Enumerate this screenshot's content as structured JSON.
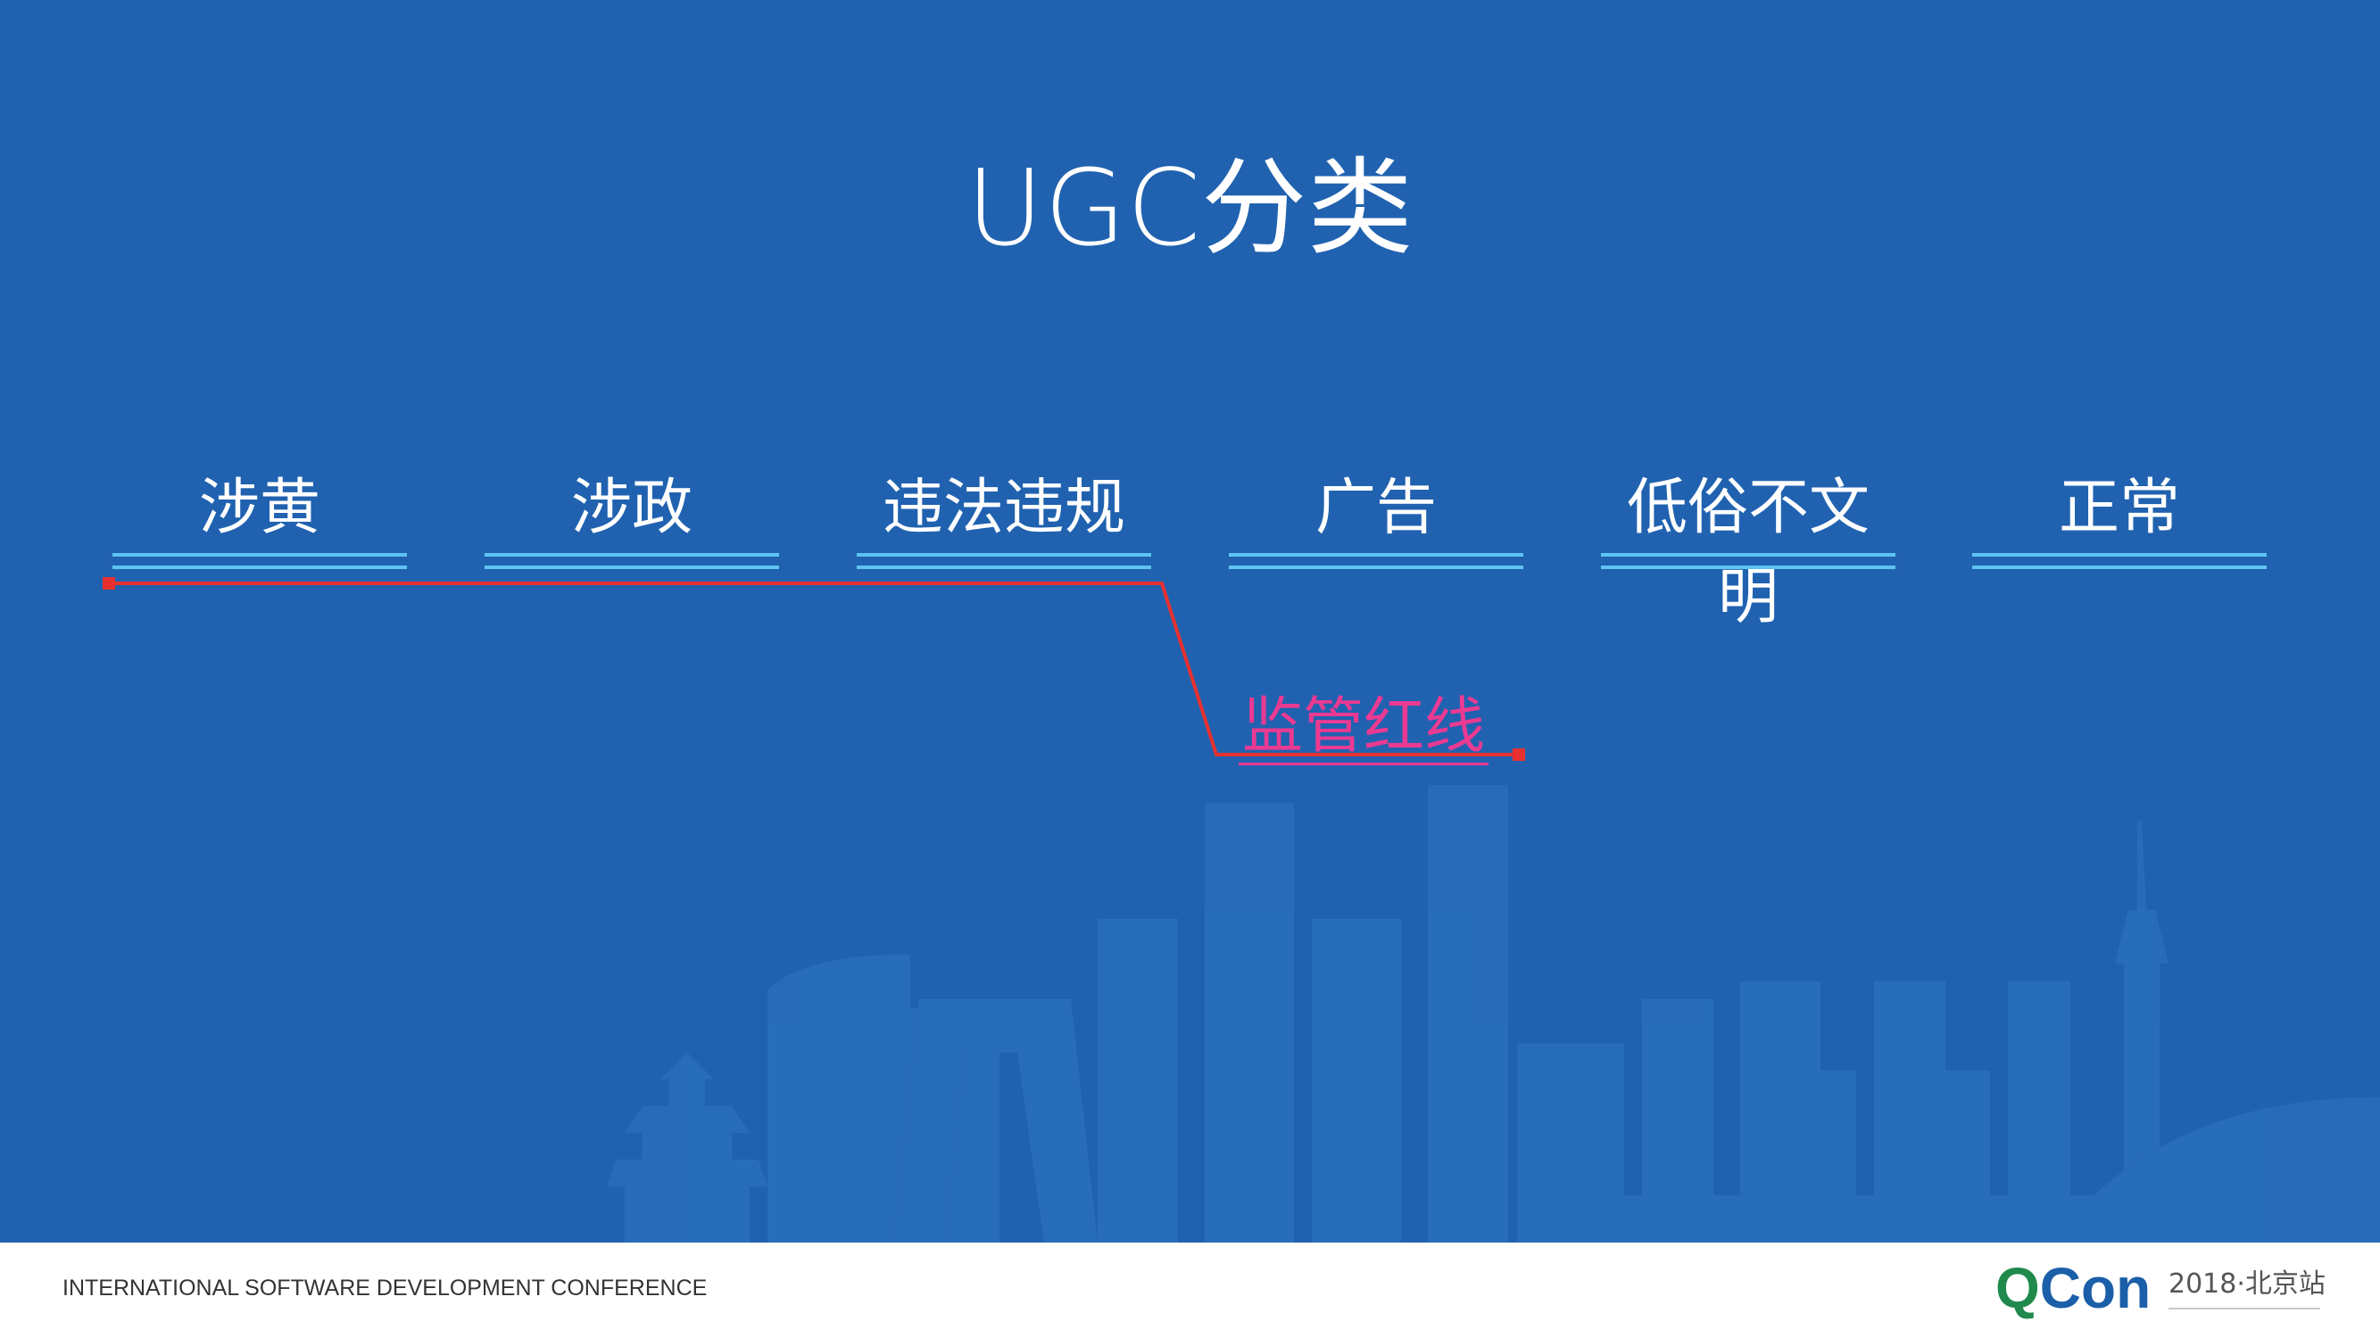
{
  "slide": {
    "title": "UGC分类",
    "background_color": "#2062b0",
    "categories": [
      {
        "label": "涉黄"
      },
      {
        "label": "涉政"
      },
      {
        "label": "违法违规"
      },
      {
        "label": "广告"
      },
      {
        "label": "低俗不文明"
      },
      {
        "label": "正常"
      }
    ],
    "underline_color": "#5fc3f2",
    "red_line": {
      "label": "监管红线",
      "line_color": "#e8312f",
      "label_color": "#ea3a92"
    }
  },
  "footer": {
    "conference_text": "INTERNATIONAL SOFTWARE DEVELOPMENT CONFERENCE",
    "logo_q": "Q",
    "logo_con": "Con",
    "event": "2018·北京站"
  }
}
